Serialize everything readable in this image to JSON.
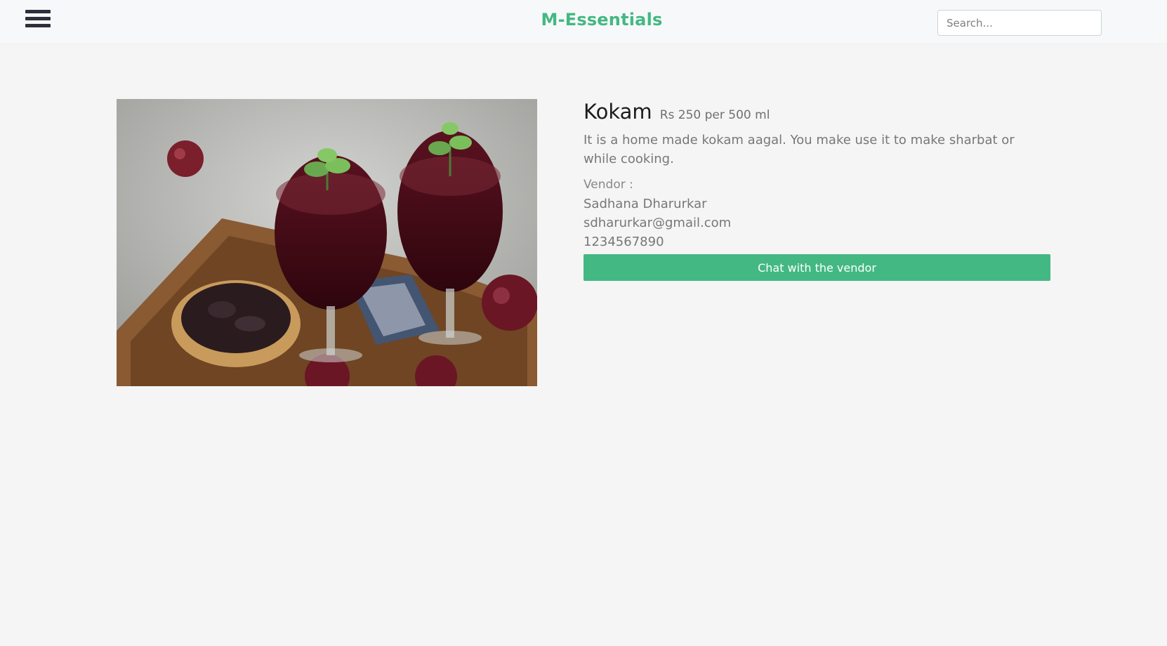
{
  "header": {
    "menu_icon": "hamburger-menu-icon",
    "brand": "M-Essentials",
    "search_placeholder": "Search..."
  },
  "colors": {
    "accent": "#43b883",
    "navbar_bg": "#f7f8f9",
    "page_bg": "#f5f5f5",
    "menu_icon": "#2d2f3b"
  },
  "product": {
    "name": "Kokam",
    "price": "Rs 250 per 500 ml",
    "description": "It is a home made kokam aagal. You make use it to make sharbat or while cooking.",
    "vendor_label": "Vendor :",
    "vendor": {
      "name": "Sadhana Dharurkar",
      "email": "sdharurkar@gmail.com",
      "phone": "1234567890"
    },
    "chat_button_label": "Chat with the vendor"
  }
}
